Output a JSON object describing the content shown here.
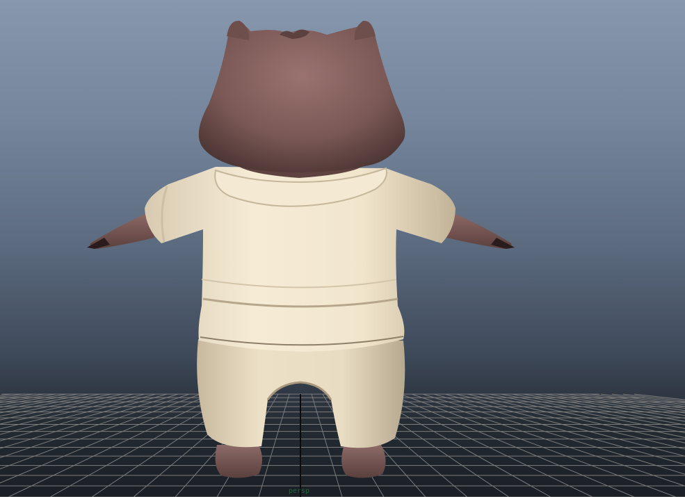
{
  "viewport": {
    "camera_label": "persp",
    "background_colors": {
      "sky_top": "#8797ad",
      "sky_bottom": "#1a1f25",
      "grid_line": "#7c7c7c",
      "grid_axis": "#0c0c0c"
    }
  },
  "model": {
    "fur_color": "#82605d",
    "shirt_color": "#efe3c9",
    "claw_color": "#2a1c1c"
  }
}
